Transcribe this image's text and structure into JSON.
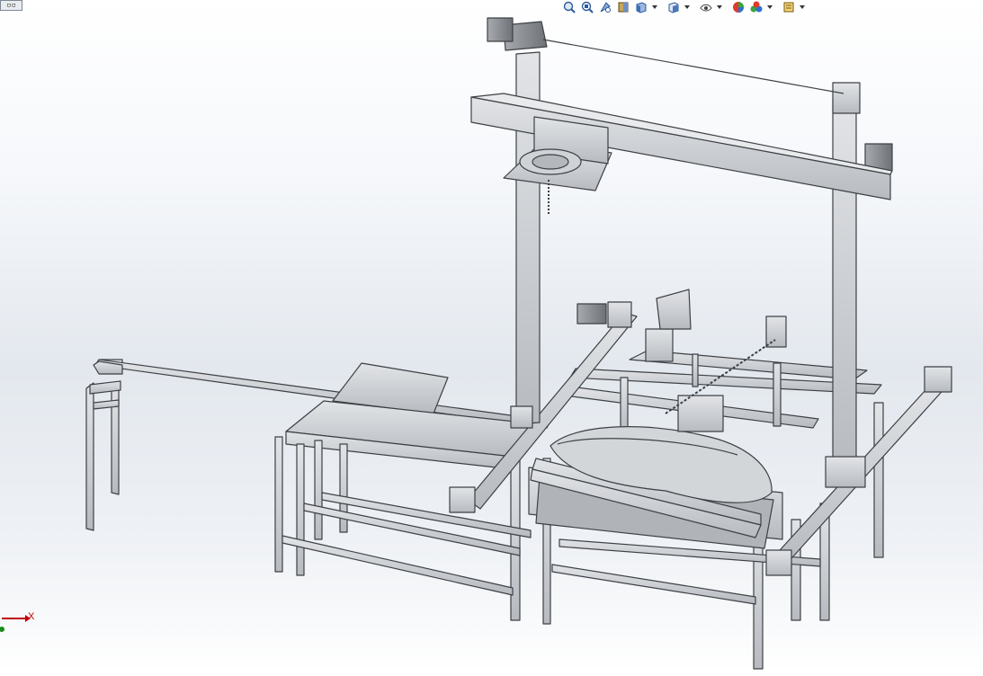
{
  "window": {
    "corner_button_label": "▫▫"
  },
  "toolbar": {
    "items": [
      {
        "icon": "zoom-to-fit-icon"
      },
      {
        "icon": "zoom-to-area-icon"
      },
      {
        "icon": "previous-view-icon"
      },
      {
        "icon": "section-view-icon"
      },
      {
        "icon": "view-orientation-icon",
        "dropdown": true
      },
      {
        "icon": "display-style-icon",
        "dropdown": true
      },
      {
        "icon": "hide-show-items-icon",
        "dropdown": true
      },
      {
        "icon": "edit-appearance-icon"
      },
      {
        "icon": "apply-scene-icon",
        "dropdown": true
      },
      {
        "icon": "view-settings-icon",
        "dropdown": true
      }
    ]
  },
  "triad": {
    "x_label": "X"
  },
  "colors": {
    "frame_metal": "#c9ccd0",
    "frame_edge": "#3d4045",
    "background_top": "#ffffff",
    "background_mid": "#e3e8ee",
    "axis_x": "#c0000a",
    "axis_y": "#1a8a1a"
  }
}
